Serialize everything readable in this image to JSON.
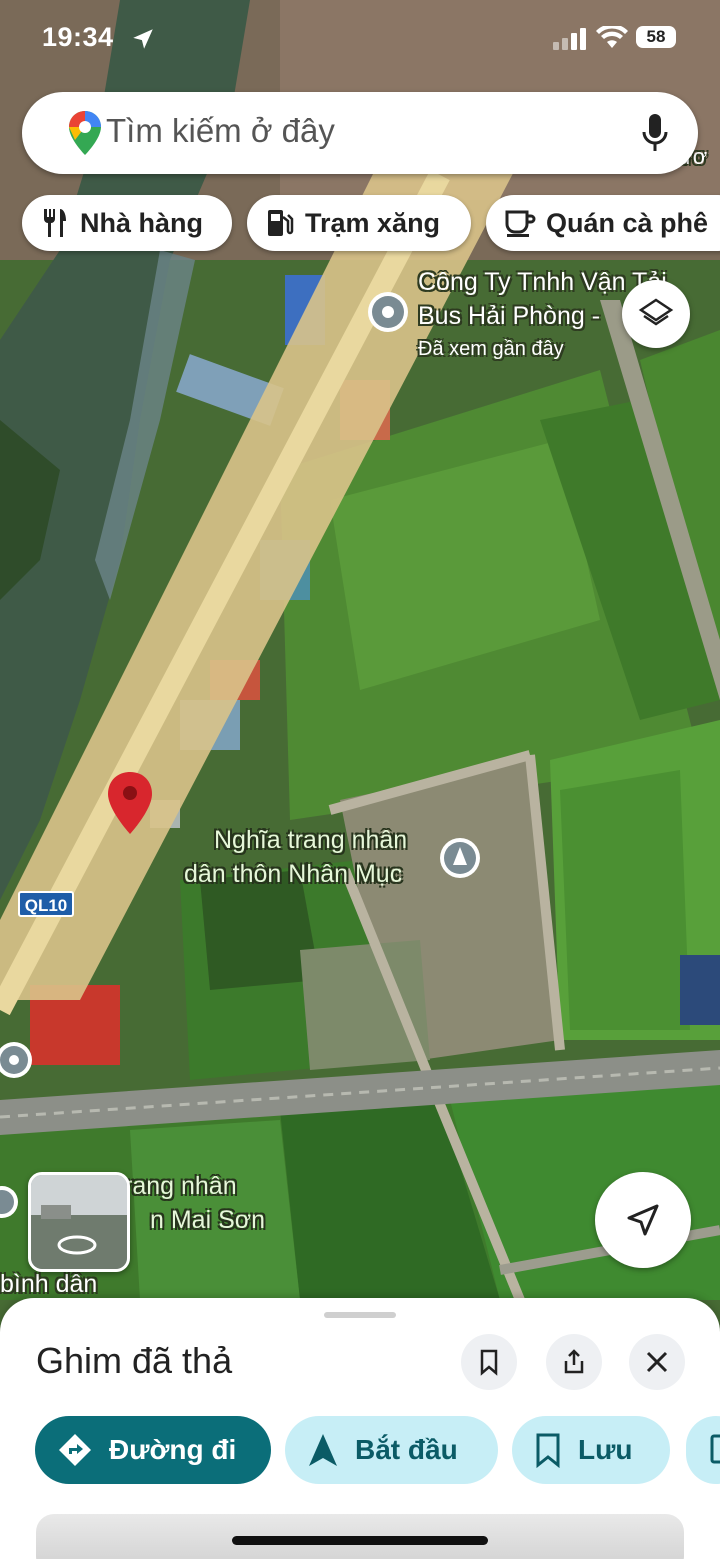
{
  "status_bar": {
    "time": "19:34",
    "battery": "58"
  },
  "search": {
    "placeholder": "Tìm kiếm ở đây"
  },
  "chips": [
    {
      "label": "Nhà hàng",
      "icon": "restaurant-icon"
    },
    {
      "label": "Trạm xăng",
      "icon": "gas-station-icon"
    },
    {
      "label": "Quán cà phê",
      "icon": "coffee-icon"
    }
  ],
  "map": {
    "place_1": {
      "line1": "Công Ty Tnhh Vận Tải",
      "line2": "Bus Hải Phòng -",
      "sub": "Đã xem gần đây"
    },
    "place_2": {
      "line1": "Nghĩa trang nhân",
      "line2": "dân thôn Nhân Mục"
    },
    "place_3": {
      "line1": "rang nhân",
      "line2": "n Mai Sơn"
    },
    "place_4": {
      "line1": "bình dân"
    },
    "road_shield": "QL10",
    "top_right_fragment": "ươ"
  },
  "sheet": {
    "title": "Ghim đã thả",
    "actions": [
      {
        "label": "Đường đi",
        "icon": "directions-icon"
      },
      {
        "label": "Bắt đầu",
        "icon": "navigation-arrow-icon"
      },
      {
        "label": "Lưu",
        "icon": "bookmark-icon"
      }
    ]
  },
  "colors": {
    "primary": "#0b6e79",
    "secondary": "#c7eef6",
    "pin": "#d8262d"
  }
}
